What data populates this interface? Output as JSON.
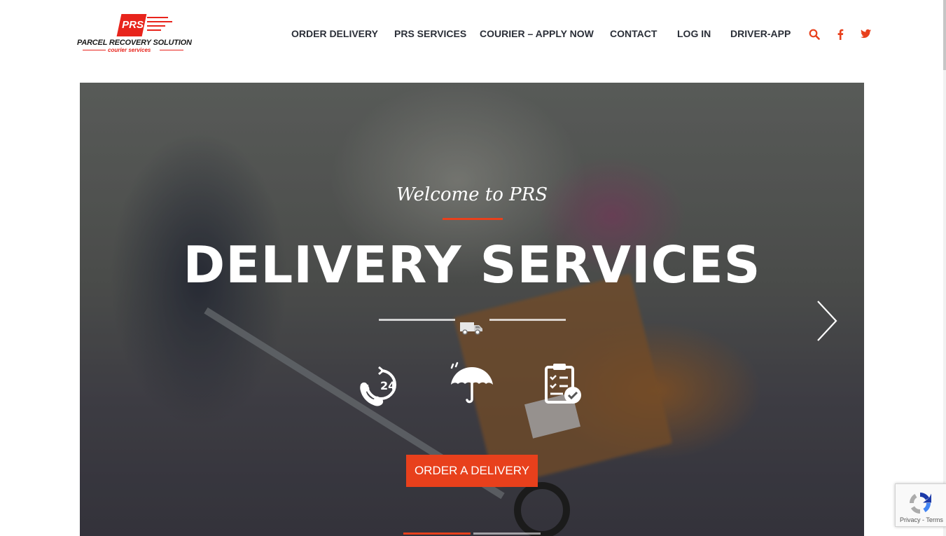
{
  "brand": {
    "mark": "PRS",
    "name": "PARCEL RECOVERY SOLUTION",
    "tagline": "courier services",
    "accent_color": "#e8401c"
  },
  "nav": {
    "items": [
      {
        "label": "ORDER DELIVERY"
      },
      {
        "label": "PRS SERVICES"
      },
      {
        "label": "COURIER – APPLY NOW"
      },
      {
        "label": "CONTACT"
      },
      {
        "label": "LOG IN"
      },
      {
        "label": "DRIVER-APP"
      }
    ],
    "icons": [
      "search-icon",
      "facebook-icon",
      "twitter-icon"
    ]
  },
  "hero": {
    "kicker": "Welcome to PRS",
    "headline": "DELIVERY SERVICES",
    "features": [
      "phone-24-icon",
      "umbrella-icon",
      "clipboard-check-icon"
    ],
    "cta_label": "ORDER A DELIVERY",
    "slider": {
      "slide_count": 2,
      "active_index": 0
    }
  },
  "recaptcha": {
    "footer": "Privacy - Terms"
  }
}
